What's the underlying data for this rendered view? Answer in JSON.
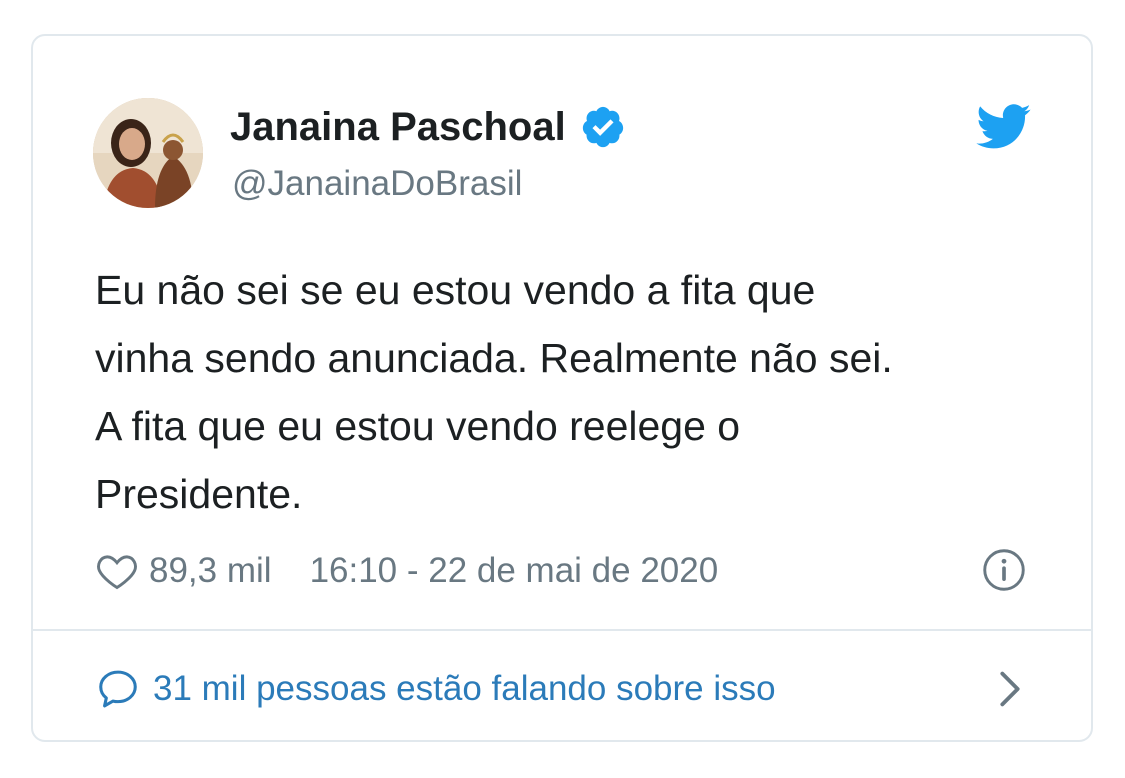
{
  "author": {
    "name": "Janaina Paschoal",
    "handle": "@JanainaDoBrasil",
    "verified": true,
    "avatar": "profile-photo"
  },
  "tweet": {
    "lines": [
      "Eu não sei se eu estou vendo a fita que",
      "vinha sendo anunciada. Realmente não sei.",
      "A fita que eu estou vendo reelege o",
      "Presidente."
    ],
    "likes": "89,3 mil",
    "timestamp": "16:10 - 22 de mai de 2020"
  },
  "footer": {
    "conversation_label": "31 mil pessoas estão falando sobre isso"
  },
  "icons": {
    "platform": "twitter-bird-icon",
    "like": "heart-icon",
    "info": "info-icon",
    "reply": "speech-bubble-icon",
    "more": "chevron-right-icon",
    "verified": "verified-badge-icon"
  },
  "colors": {
    "brand": "#1da1f2",
    "link": "#2b7bb9",
    "muted": "#697882",
    "text": "#1c2022",
    "border": "#e1e8ed"
  }
}
